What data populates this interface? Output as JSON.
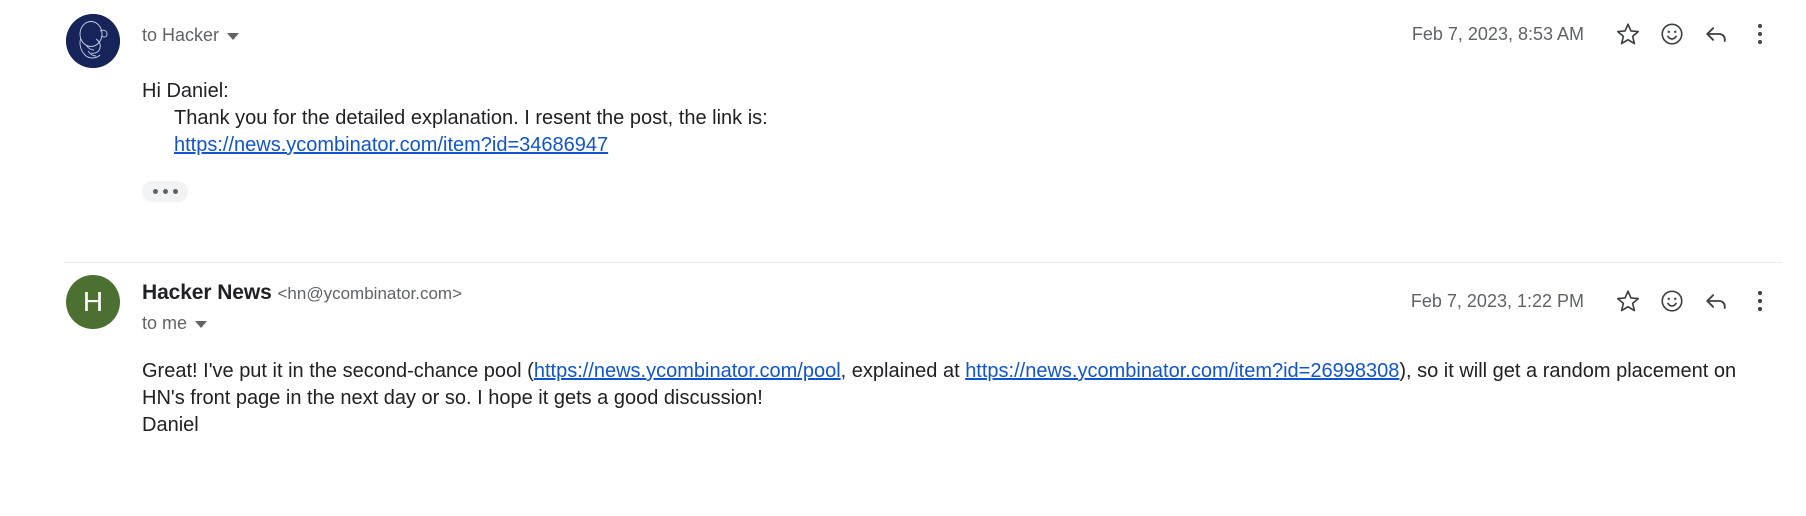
{
  "thread": {
    "messages": [
      {
        "sender_name": "",
        "sender_email": "",
        "recipient": "to Hacker",
        "date": "Feb 7, 2023, 8:53 AM",
        "avatar_type": "image",
        "avatar_color": "#16245a",
        "body": {
          "greeting": "Hi Daniel:",
          "paragraph_prefix": "Thank you for the detailed explanation. I resent the post, the link is:",
          "link_text": "https://news.ycombinator.com/item?id=34686947",
          "link_href": "https://news.ycombinator.com/item?id=34686947"
        },
        "trimmed_label": "Show trimmed content"
      },
      {
        "sender_name": "Hacker News",
        "sender_email": "<hn@ycombinator.com>",
        "recipient": "to me",
        "date": "Feb 7, 2023, 1:22 PM",
        "avatar_type": "letter",
        "avatar_letter": "H",
        "avatar_color": "#4c7031",
        "body": {
          "seg1": "Great! I've put it in the second-chance pool (",
          "link1_text": "https://news.ycombinator.com/pool",
          "link1_href": "https://news.ycombinator.com/pool",
          "seg2": ", explained at ",
          "link2_text": "https://news.ycombinator.com/item?id=26998308",
          "link2_href": "https://news.ycombinator.com/item?id=26998308",
          "seg3": "), so it will get a random placement on",
          "line2": "HN's front page in the next day or so. I hope it gets a good discussion!",
          "signature": "Daniel"
        }
      }
    ],
    "actions": {
      "star_label": "Star",
      "emoji_label": "Add reaction",
      "reply_label": "Reply",
      "more_label": "More"
    },
    "colors": {
      "link": "#1155cc",
      "text": "#202124",
      "muted": "#5f6368",
      "divider": "#e8eaed"
    }
  }
}
